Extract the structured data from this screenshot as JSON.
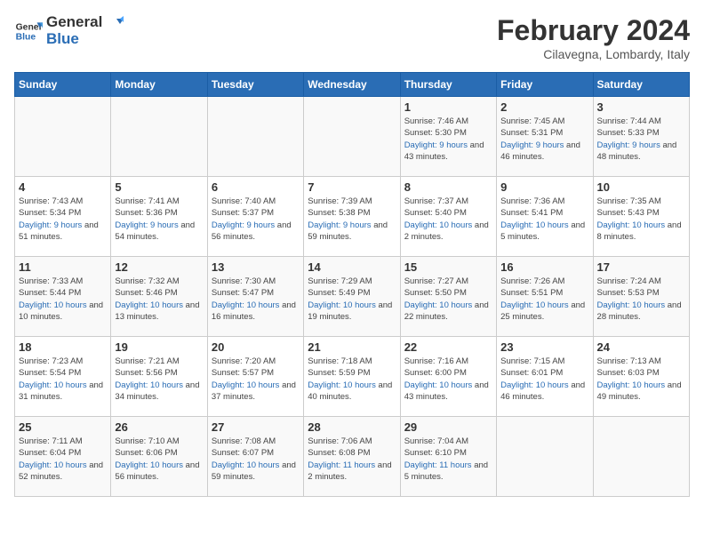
{
  "header": {
    "logo_general": "General",
    "logo_blue": "Blue",
    "title": "February 2024",
    "subtitle": "Cilavegna, Lombardy, Italy"
  },
  "columns": [
    "Sunday",
    "Monday",
    "Tuesday",
    "Wednesday",
    "Thursday",
    "Friday",
    "Saturday"
  ],
  "weeks": [
    [
      {
        "day": "",
        "info": ""
      },
      {
        "day": "",
        "info": ""
      },
      {
        "day": "",
        "info": ""
      },
      {
        "day": "",
        "info": ""
      },
      {
        "day": "1",
        "info": "Sunrise: 7:46 AM\nSunset: 5:30 PM\nDaylight: 9 hours\nand 43 minutes."
      },
      {
        "day": "2",
        "info": "Sunrise: 7:45 AM\nSunset: 5:31 PM\nDaylight: 9 hours\nand 46 minutes."
      },
      {
        "day": "3",
        "info": "Sunrise: 7:44 AM\nSunset: 5:33 PM\nDaylight: 9 hours\nand 48 minutes."
      }
    ],
    [
      {
        "day": "4",
        "info": "Sunrise: 7:43 AM\nSunset: 5:34 PM\nDaylight: 9 hours\nand 51 minutes."
      },
      {
        "day": "5",
        "info": "Sunrise: 7:41 AM\nSunset: 5:36 PM\nDaylight: 9 hours\nand 54 minutes."
      },
      {
        "day": "6",
        "info": "Sunrise: 7:40 AM\nSunset: 5:37 PM\nDaylight: 9 hours\nand 56 minutes."
      },
      {
        "day": "7",
        "info": "Sunrise: 7:39 AM\nSunset: 5:38 PM\nDaylight: 9 hours\nand 59 minutes."
      },
      {
        "day": "8",
        "info": "Sunrise: 7:37 AM\nSunset: 5:40 PM\nDaylight: 10 hours\nand 2 minutes."
      },
      {
        "day": "9",
        "info": "Sunrise: 7:36 AM\nSunset: 5:41 PM\nDaylight: 10 hours\nand 5 minutes."
      },
      {
        "day": "10",
        "info": "Sunrise: 7:35 AM\nSunset: 5:43 PM\nDaylight: 10 hours\nand 8 minutes."
      }
    ],
    [
      {
        "day": "11",
        "info": "Sunrise: 7:33 AM\nSunset: 5:44 PM\nDaylight: 10 hours\nand 10 minutes."
      },
      {
        "day": "12",
        "info": "Sunrise: 7:32 AM\nSunset: 5:46 PM\nDaylight: 10 hours\nand 13 minutes."
      },
      {
        "day": "13",
        "info": "Sunrise: 7:30 AM\nSunset: 5:47 PM\nDaylight: 10 hours\nand 16 minutes."
      },
      {
        "day": "14",
        "info": "Sunrise: 7:29 AM\nSunset: 5:49 PM\nDaylight: 10 hours\nand 19 minutes."
      },
      {
        "day": "15",
        "info": "Sunrise: 7:27 AM\nSunset: 5:50 PM\nDaylight: 10 hours\nand 22 minutes."
      },
      {
        "day": "16",
        "info": "Sunrise: 7:26 AM\nSunset: 5:51 PM\nDaylight: 10 hours\nand 25 minutes."
      },
      {
        "day": "17",
        "info": "Sunrise: 7:24 AM\nSunset: 5:53 PM\nDaylight: 10 hours\nand 28 minutes."
      }
    ],
    [
      {
        "day": "18",
        "info": "Sunrise: 7:23 AM\nSunset: 5:54 PM\nDaylight: 10 hours\nand 31 minutes."
      },
      {
        "day": "19",
        "info": "Sunrise: 7:21 AM\nSunset: 5:56 PM\nDaylight: 10 hours\nand 34 minutes."
      },
      {
        "day": "20",
        "info": "Sunrise: 7:20 AM\nSunset: 5:57 PM\nDaylight: 10 hours\nand 37 minutes."
      },
      {
        "day": "21",
        "info": "Sunrise: 7:18 AM\nSunset: 5:59 PM\nDaylight: 10 hours\nand 40 minutes."
      },
      {
        "day": "22",
        "info": "Sunrise: 7:16 AM\nSunset: 6:00 PM\nDaylight: 10 hours\nand 43 minutes."
      },
      {
        "day": "23",
        "info": "Sunrise: 7:15 AM\nSunset: 6:01 PM\nDaylight: 10 hours\nand 46 minutes."
      },
      {
        "day": "24",
        "info": "Sunrise: 7:13 AM\nSunset: 6:03 PM\nDaylight: 10 hours\nand 49 minutes."
      }
    ],
    [
      {
        "day": "25",
        "info": "Sunrise: 7:11 AM\nSunset: 6:04 PM\nDaylight: 10 hours\nand 52 minutes."
      },
      {
        "day": "26",
        "info": "Sunrise: 7:10 AM\nSunset: 6:06 PM\nDaylight: 10 hours\nand 56 minutes."
      },
      {
        "day": "27",
        "info": "Sunrise: 7:08 AM\nSunset: 6:07 PM\nDaylight: 10 hours\nand 59 minutes."
      },
      {
        "day": "28",
        "info": "Sunrise: 7:06 AM\nSunset: 6:08 PM\nDaylight: 11 hours\nand 2 minutes."
      },
      {
        "day": "29",
        "info": "Sunrise: 7:04 AM\nSunset: 6:10 PM\nDaylight: 11 hours\nand 5 minutes."
      },
      {
        "day": "",
        "info": ""
      },
      {
        "day": "",
        "info": ""
      }
    ]
  ]
}
